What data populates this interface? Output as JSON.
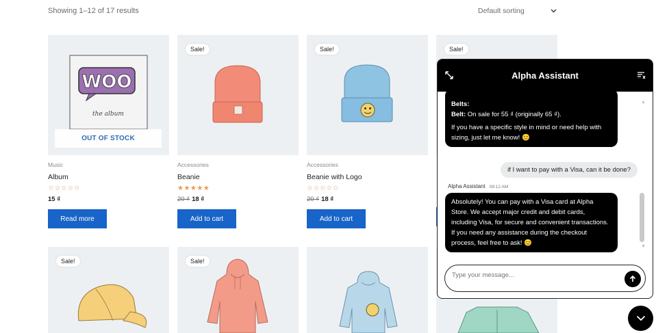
{
  "shop": {
    "results_count": "Showing 1–12 of 17 results",
    "sorting": {
      "selected": "Default sorting",
      "icon": "chevron-down-icon"
    }
  },
  "products_row1": [
    {
      "category": "Music",
      "title": "Album",
      "stars": "☆☆☆☆☆",
      "old_price": "",
      "price": "15 ₫",
      "button": "Read more",
      "badge": "",
      "stock": "OUT OF STOCK"
    },
    {
      "category": "Accessories",
      "title": "Beanie",
      "stars": "★★★★★",
      "old_price": "20 ₫",
      "price": "18 ₫",
      "button": "Add to cart",
      "badge": "Sale!"
    },
    {
      "category": "Accessories",
      "title": "Beanie with Logo",
      "stars": "☆☆☆☆☆",
      "old_price": "20 ₫",
      "price": "18 ₫",
      "button": "Add to cart",
      "badge": "Sale!"
    },
    {
      "badge": "Sale!"
    }
  ],
  "products_row2": [
    {
      "badge": "Sale!"
    },
    {
      "badge": "Sale!"
    },
    {
      "badge": ""
    },
    {
      "badge": ""
    }
  ],
  "album_art": {
    "word": "WOO",
    "sub": "the album"
  },
  "chat": {
    "title": "Alpha Assistant",
    "messages": {
      "bot1_line1": "Belts:",
      "bot1_belt_label": "Belt:",
      "bot1_belt_text": " On sale for 55 ₫ (originally 65 ₫).",
      "bot1_line3": "If you have a specific style in mind or need help with sizing, just let me know! 😊",
      "user1": "if I want to pay with a Visa, can it be done?",
      "sender": "Alpha Assistant",
      "time": "08:12 AM",
      "bot2": "Absolutely! You can pay with a Visa card at Alpha Store. We accept major credit and debit cards, including Visa, for secure and convenient transactions. If you need any assistance during the checkout process, feel free to ask! 😊"
    },
    "input_placeholder": "Type your message...",
    "colors": {
      "header": "#000000",
      "bot_bubble": "#000000",
      "user_bubble": "#e9eaeb",
      "button_blue": "#1864c8"
    }
  }
}
